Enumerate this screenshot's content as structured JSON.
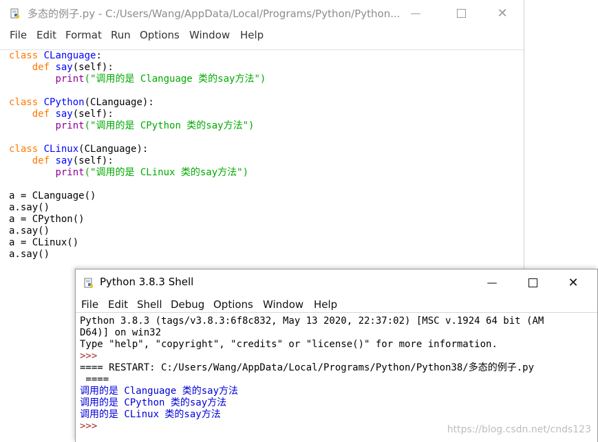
{
  "editor": {
    "title": "多态的例子.py - C:/Users/Wang/AppData/Local/Programs/Python/Python...",
    "menu": [
      "File",
      "Edit",
      "Format",
      "Run",
      "Options",
      "Window",
      "Help"
    ],
    "code": {
      "c1_kw": "class",
      "c1_name": "CLanguage",
      "c1_end": ":",
      "c1_def": "def",
      "c1_say": "say",
      "c1_args": "(self):",
      "c1_print": "print",
      "c1_str": "(\"调用的是 Clanguage 类的say方法\")",
      "c2_kw": "class",
      "c2_name": "CPython",
      "c2_end": "(CLanguage):",
      "c2_def": "def",
      "c2_say": "say",
      "c2_args": "(self):",
      "c2_print": "print",
      "c2_str": "(\"调用的是 CPython 类的say方法\")",
      "c3_kw": "class",
      "c3_name": "CLinux",
      "c3_end": "(CLanguage):",
      "c3_def": "def",
      "c3_say": "say",
      "c3_args": "(self):",
      "c3_print": "print",
      "c3_str": "(\"调用的是 CLinux 类的say方法\")",
      "m1": "a = CLanguage()",
      "m2": "a.say()",
      "m3": "a = CPython()",
      "m4": "a.say()",
      "m5": "a = CLinux()",
      "m6": "a.say()"
    }
  },
  "shell": {
    "title": "Python 3.8.3 Shell",
    "menu": [
      "File",
      "Edit",
      "Shell",
      "Debug",
      "Options",
      "Window",
      "Help"
    ],
    "lines": {
      "l1": "Python 3.8.3 (tags/v3.8.3:6f8c832, May 13 2020, 22:37:02) [MSC v.1924 64 bit (AM",
      "l2": "D64)] on win32",
      "l3": "Type \"help\", \"copyright\", \"credits\" or \"license()\" for more information.",
      "p1": ">>>",
      "l4": "==== RESTART: C:/Users/Wang/AppData/Local/Programs/Python/Python38/多态的例子.py",
      "l5": " ====",
      "o1": "调用的是 Clanguage 类的say方法",
      "o2": "调用的是 CPython 类的say方法",
      "o3": "调用的是 CLinux 类的say方法",
      "p2": ">>>"
    }
  },
  "watermark": "https://blog.csdn.net/cnds123"
}
